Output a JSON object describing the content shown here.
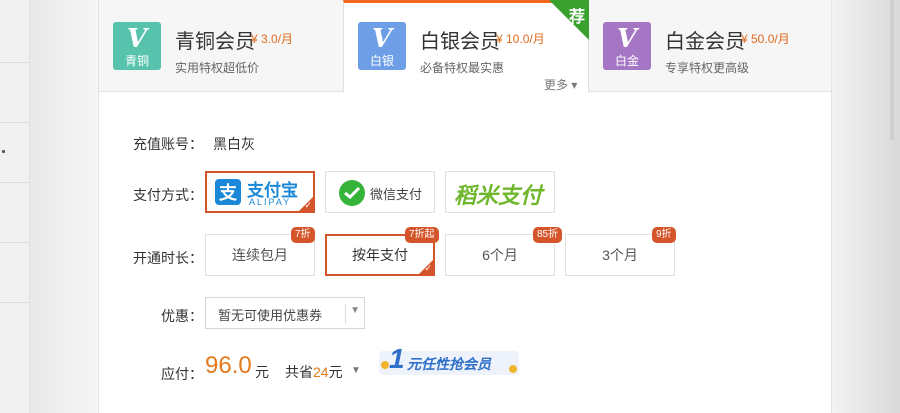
{
  "tabs": [
    {
      "badge_letter": "V",
      "badge_label": "青铜",
      "name": "青铜会员",
      "price": "¥ 3.0/月",
      "desc": "实用特权超低价",
      "color": "#57c3ad",
      "active": false
    },
    {
      "badge_letter": "V",
      "badge_label": "白银",
      "name": "白银会员",
      "price": "¥ 10.0/月",
      "desc": "必备特权最实惠",
      "color": "#6d9ee6",
      "active": true,
      "more": "更多 ▾",
      "corner": "荐"
    },
    {
      "badge_letter": "V",
      "badge_label": "白金",
      "name": "白金会员",
      "price": "¥ 50.0/月",
      "desc": "专享特权更高级",
      "color": "#a476c3",
      "active": false
    }
  ],
  "form": {
    "account_label": "充值账号：",
    "account_value": "黑白灰",
    "pay_label": "支付方式：",
    "pay_methods": [
      {
        "name": "支付宝",
        "sub": "ALIPAY",
        "icon": "alipay-icon",
        "color": "#1a88d6"
      },
      {
        "name": "微信支付",
        "icon": "wechat-icon",
        "color": "#36b43a"
      },
      {
        "name": "稻米支付",
        "icon": "daomi-icon",
        "color": "#6fb72d"
      }
    ],
    "duration_label": "开通时长：",
    "durations": [
      {
        "label": "连续包月",
        "discount": "7折"
      },
      {
        "label": "按年支付",
        "discount": "7折起"
      },
      {
        "label": "6个月",
        "discount": "85折"
      },
      {
        "label": "3个月",
        "discount": "9折"
      }
    ],
    "coupon_label": "优惠：",
    "coupon_value": "暂无可使用优惠券",
    "pay_amount_label": "应付：",
    "amount": "96.0",
    "amount_unit": "元",
    "save_prefix": "共省",
    "save_amount": "24",
    "save_suffix": "元",
    "promo_number": "1",
    "promo_text": "元任性抢会员"
  }
}
